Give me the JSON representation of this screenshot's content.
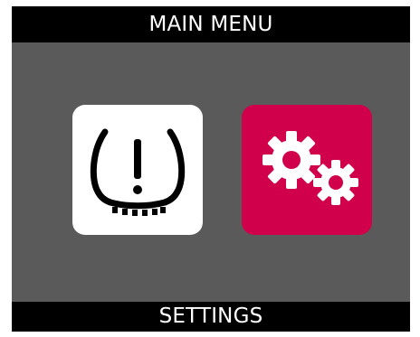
{
  "header": {
    "title": "MAIN MENU"
  },
  "menu": {
    "items": [
      {
        "name": "tpms",
        "icon": "tire-pressure-warning-icon",
        "background": "#ffffff",
        "selected": false
      },
      {
        "name": "settings",
        "icon": "gears-icon",
        "background": "#d0004a",
        "selected": true
      }
    ]
  },
  "footer": {
    "label": "SETTINGS"
  },
  "colors": {
    "bar": "#000000",
    "bar_text": "#ffffff",
    "content_background": "#5a5a5a",
    "accent": "#d0004a"
  }
}
